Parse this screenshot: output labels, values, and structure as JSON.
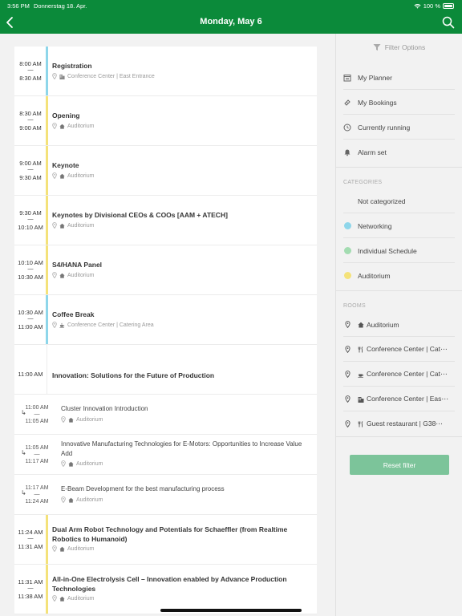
{
  "status": {
    "time": "3:56 PM",
    "date": "Donnerstag 18. Apr.",
    "battery": "100 %"
  },
  "nav": {
    "title": "Monday, May 6"
  },
  "colors": {
    "brand": "#0b8a3a",
    "networking": "#8ed6ea",
    "individual": "#a3dcb1",
    "auditorium": "#f4e27a",
    "reset": "#7cc49a"
  },
  "sessions": [
    {
      "start": "8:00 AM",
      "end": "8:30 AM",
      "title": "Registration",
      "location": "Conference Center | East Entrance",
      "icon": "building-icon",
      "color": "#8ed6ea"
    },
    {
      "start": "8:30 AM",
      "end": "9:00 AM",
      "title": "Opening",
      "location": "Auditorium",
      "icon": "home-icon",
      "color": "#f4e27a"
    },
    {
      "start": "9:00 AM",
      "end": "9:30 AM",
      "title": "Keynote",
      "location": "Auditorium",
      "icon": "home-icon",
      "color": "#f4e27a"
    },
    {
      "start": "9:30 AM",
      "end": "10:10 AM",
      "title": "Keynotes by Divisional CEOs & COOs [AAM + ATECH]",
      "location": "Auditorium",
      "icon": "home-icon",
      "color": "#f4e27a"
    },
    {
      "start": "10:10 AM",
      "end": "10:30 AM",
      "title": "S4/HANA Panel",
      "location": "Auditorium",
      "icon": "home-icon",
      "color": "#f4e27a"
    },
    {
      "start": "10:30 AM",
      "end": "11:00 AM",
      "title": "Coffee Break",
      "location": "Conference Center | Catering Area",
      "icon": "coffee-icon",
      "color": "#8ed6ea"
    }
  ],
  "block": {
    "start": "11:00 AM",
    "title": "Innovation: Solutions for the Future of Production",
    "subs": [
      {
        "start": "11:00 AM",
        "end": "11:05 AM",
        "title": "Cluster Innovation Introduction",
        "location": "Auditorium"
      },
      {
        "start": "11:05 AM",
        "end": "11:17 AM",
        "title": "Innovative Manufacturing Technologies for E-Motors: Opportunities to Increase Value Add",
        "location": "Auditorium"
      },
      {
        "start": "11:17 AM",
        "end": "11:24 AM",
        "title": "E-Beam Development for the best manufacturing process",
        "location": "Auditorium"
      }
    ]
  },
  "sessions2": [
    {
      "start": "11:24 AM",
      "end": "11:31 AM",
      "title": "Dual Arm Robot Technology and Potentials for Schaeffler (from Realtime Robotics to Humanoid)",
      "location": "Auditorium",
      "color": "#f4e27a"
    },
    {
      "start": "11:31 AM",
      "end": "11:38 AM",
      "title": "All-in-One Electrolysis Cell – Innovation enabled by Advance Production Technologies",
      "location": "Auditorium",
      "color": "#f4e27a"
    }
  ],
  "sidebar": {
    "filter_title": "Filter Options",
    "menu": [
      "My Planner",
      "My Bookings",
      "Currently running",
      "Alarm set"
    ],
    "categories_title": "CATEGORIES",
    "categories": [
      "Not categorized",
      "Networking",
      "Individual Schedule",
      "Auditorium"
    ],
    "rooms_title": "ROOMS",
    "rooms": [
      "Auditorium",
      "Conference Center | Cat⋯",
      "Conference Center | Cat⋯",
      "Conference Center | Eas⋯",
      "Guest restaurant | G38⋯"
    ],
    "reset_label": "Reset filter"
  }
}
